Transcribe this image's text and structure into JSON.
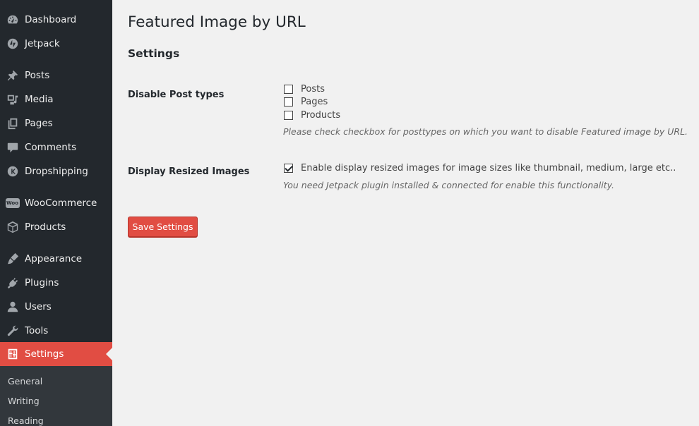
{
  "sidebar": {
    "items": [
      {
        "label": "Dashboard",
        "icon": "dashboard-icon"
      },
      {
        "label": "Jetpack",
        "icon": "jetpack-icon"
      },
      {
        "label": "Posts",
        "icon": "pin-icon"
      },
      {
        "label": "Media",
        "icon": "media-icon"
      },
      {
        "label": "Pages",
        "icon": "pages-icon"
      },
      {
        "label": "Comments",
        "icon": "comment-icon"
      },
      {
        "label": "Dropshipping",
        "icon": "dropshipping-icon"
      },
      {
        "label": "WooCommerce",
        "icon": "woocommerce-icon"
      },
      {
        "label": "Products",
        "icon": "box-icon"
      },
      {
        "label": "Appearance",
        "icon": "brush-icon"
      },
      {
        "label": "Plugins",
        "icon": "plug-icon"
      },
      {
        "label": "Users",
        "icon": "user-icon"
      },
      {
        "label": "Tools",
        "icon": "wrench-icon"
      },
      {
        "label": "Settings",
        "icon": "sliders-icon"
      }
    ],
    "current": "Settings",
    "submenu": [
      "General",
      "Writing",
      "Reading"
    ],
    "woo_badge": "Woo",
    "accent_color": "#e14d43",
    "background_color": "#23282d"
  },
  "main": {
    "title": "Featured Image by URL",
    "section_title": "Settings",
    "disable_post_types": {
      "label": "Disable Post types",
      "options": [
        {
          "label": "Posts",
          "checked": false
        },
        {
          "label": "Pages",
          "checked": false
        },
        {
          "label": "Products",
          "checked": false
        }
      ],
      "description": "Please check checkbox for posttypes on which you want to disable Featured image by URL."
    },
    "display_resized": {
      "label": "Display Resized Images",
      "option_label": "Enable display resized images for image sizes like thumbnail, medium, large etc..",
      "checked": true,
      "description": "You need Jetpack plugin installed & connected for enable this functionality."
    },
    "save_label": "Save Settings"
  }
}
